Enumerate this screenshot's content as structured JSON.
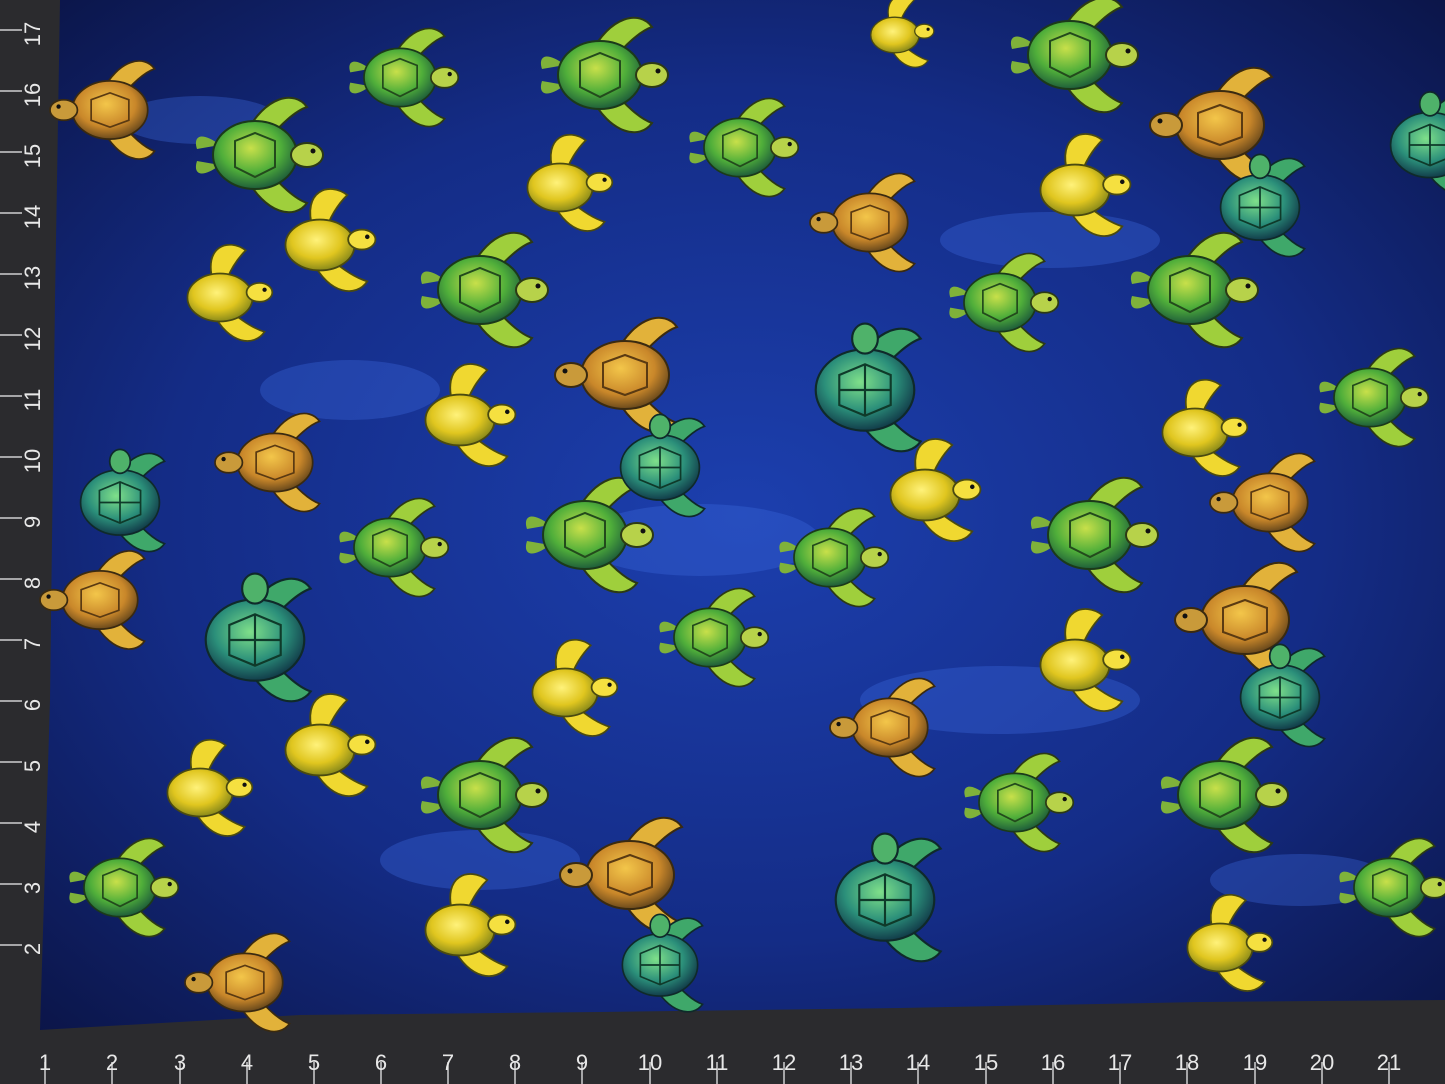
{
  "photo": {
    "subject": "sea-turtle-fabric",
    "colors": {
      "water_dark": "#0a1240",
      "water_mid": "#16379a",
      "water_light": "#2d56c8",
      "turtle_yellow": "#e8d22a",
      "turtle_green": "#3fae3c",
      "turtle_teal": "#2b8f7a",
      "turtle_orange": "#d99a2a",
      "mat": "#2b2b2e",
      "ruler_text": "#e8e8e8"
    }
  },
  "ruler": {
    "bottom_numbers": [
      "1",
      "2",
      "3",
      "4",
      "5",
      "6",
      "7",
      "8",
      "9",
      "10",
      "11",
      "12",
      "13",
      "14",
      "15",
      "16",
      "17",
      "18",
      "19",
      "20",
      "21"
    ],
    "left_numbers": [
      "17",
      "16",
      "15",
      "14",
      "13",
      "12",
      "11",
      "10",
      "9",
      "8",
      "7",
      "6",
      "5",
      "4",
      "3",
      "2"
    ]
  }
}
